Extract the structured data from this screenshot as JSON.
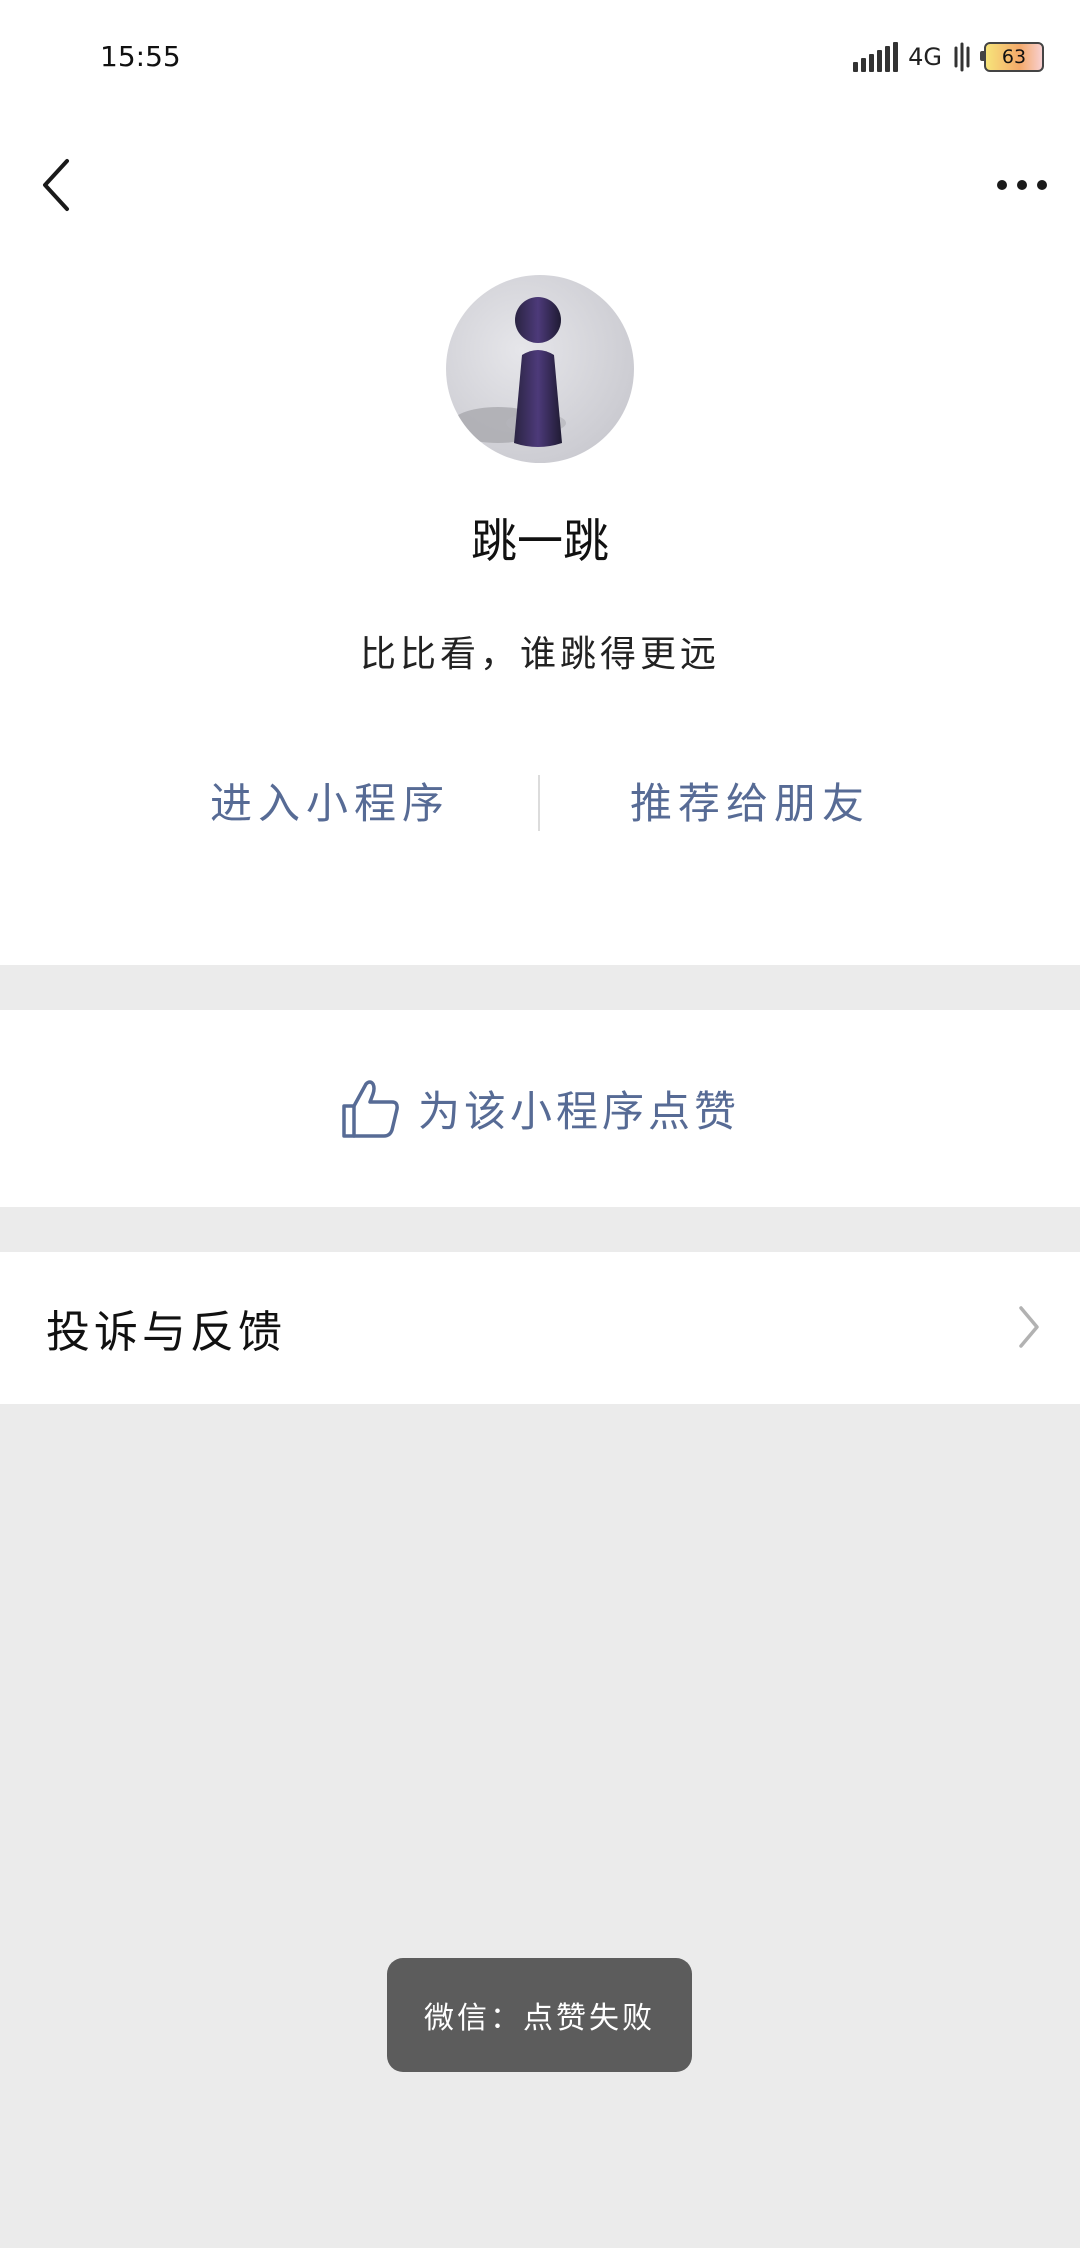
{
  "status_bar": {
    "time": "15:55",
    "network": "4G",
    "battery_level": "63",
    "icons": [
      "signal-icon",
      "wifi-icon",
      "battery-icon"
    ]
  },
  "header": {
    "back_icon": "chevron-left-icon",
    "more_icon": "ellipsis-icon"
  },
  "profile": {
    "name": "跳一跳",
    "description": "比比看，谁跳得更远",
    "avatar_icon": "game-piece-avatar"
  },
  "actions": {
    "enter_label": "进入小程序",
    "recommend_label": "推荐给朋友"
  },
  "like": {
    "icon": "thumbs-up-icon",
    "label": "为该小程序点赞"
  },
  "feedback": {
    "label": "投诉与反馈",
    "icon": "chevron-right-icon"
  },
  "toast": {
    "message": "微信：点赞失败"
  },
  "colors": {
    "link": "#576b95",
    "background": "#ebebeb",
    "toast_bg": "#5c5c5c"
  }
}
